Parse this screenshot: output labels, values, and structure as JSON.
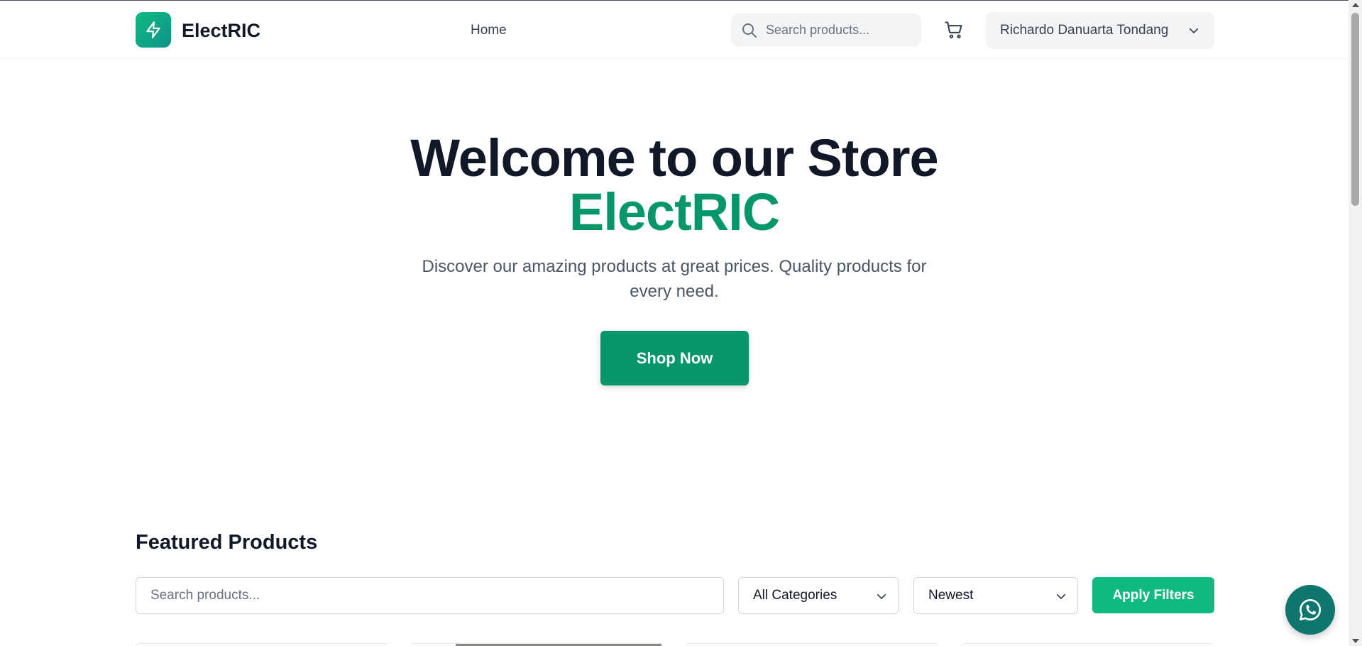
{
  "header": {
    "brand": "ElectRIC",
    "nav": {
      "home": "Home"
    },
    "search": {
      "placeholder": "Search products..."
    },
    "user": {
      "name": "Richardo Danuarta Tondang"
    }
  },
  "hero": {
    "title_line1": "Welcome to our Store",
    "title_line2": "ElectRIC",
    "subtitle": "Discover our amazing products at great prices. Quality products for every need.",
    "cta": "Shop Now"
  },
  "featured": {
    "title": "Featured Products",
    "search_placeholder": "Search products...",
    "category_selected": "All Categories",
    "sort_selected": "Newest",
    "apply_label": "Apply Filters"
  },
  "colors": {
    "brand": "#059669",
    "brand_light": "#10b981",
    "whatsapp": "#0f766e",
    "heading": "#111827"
  },
  "icons": {
    "logo": "lightning-bolt-icon",
    "search": "search-icon",
    "cart": "cart-icon",
    "dropdown": "chevron-down-icon",
    "chat": "whatsapp-icon"
  }
}
